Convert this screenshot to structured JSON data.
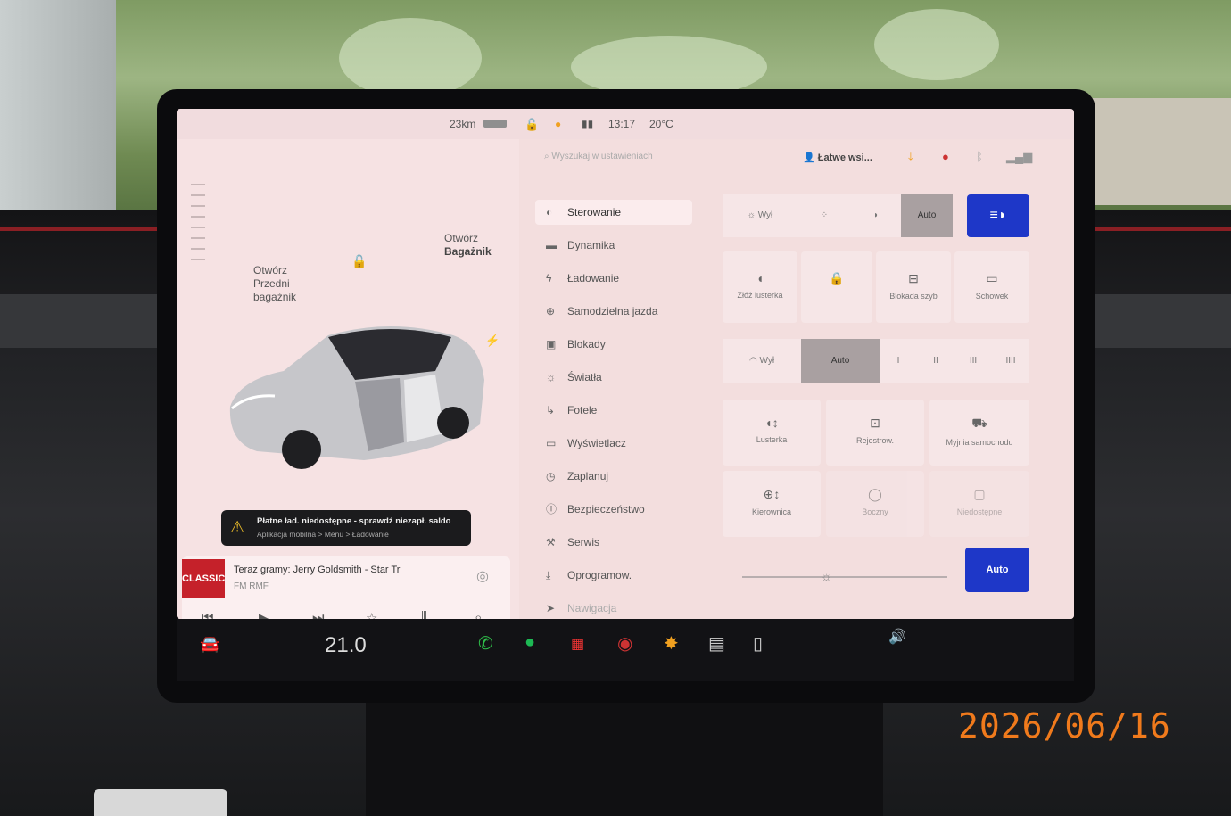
{
  "status_bar": {
    "range": "23km",
    "time": "13:17",
    "temperature": "20°C"
  },
  "car_panel": {
    "front_trunk_label": "Otwórz\nPrzedni\nbagażnik",
    "rear_trunk_label_1": "Otwórz",
    "rear_trunk_label_2": "Bagażnik",
    "warning_title": "Płatne ład. niedostępne - sprawdź niezapł. saldo",
    "warning_sub": "Aplikacja mobilna > Menu > Ładowanie"
  },
  "media": {
    "art_label": "CLASSIC",
    "now_playing": "Teraz gramy: Jerry Goldsmith - Star Tr",
    "station": "FM RMF"
  },
  "settings": {
    "search_placeholder": "Wyszukaj w ustawieniach",
    "profile_name": "Łatwe wsi...",
    "menu": [
      {
        "label": "Sterowanie",
        "icon": "toggle-icon"
      },
      {
        "label": "Dynamika",
        "icon": "car-icon"
      },
      {
        "label": "Ładowanie",
        "icon": "bolt-icon"
      },
      {
        "label": "Samodzielna jazda",
        "icon": "steering-wheel-icon"
      },
      {
        "label": "Blokady",
        "icon": "lock-icon"
      },
      {
        "label": "Światła",
        "icon": "light-icon"
      },
      {
        "label": "Fotele",
        "icon": "seat-icon"
      },
      {
        "label": "Wyświetlacz",
        "icon": "display-icon"
      },
      {
        "label": "Zaplanuj",
        "icon": "clock-icon"
      },
      {
        "label": "Bezpieczeństwo",
        "icon": "info-icon"
      },
      {
        "label": "Serwis",
        "icon": "wrench-icon"
      },
      {
        "label": "Oprogramow.",
        "icon": "download-icon"
      },
      {
        "label": "Nawigacja",
        "icon": "navigation-icon"
      }
    ],
    "lights": {
      "off": "Wył",
      "auto": "Auto"
    },
    "tiles_row1": [
      "Złóż lusterka",
      "Blokada szyb",
      "Schowek"
    ],
    "wipers": {
      "off": "Wył",
      "auto": "Auto",
      "s1": "I",
      "s2": "II",
      "s3": "III",
      "s4": "IIII"
    },
    "tiles_row2": [
      "Lusterka",
      "Rejestrow.",
      "Myjnia samochodu"
    ],
    "tiles_row3": [
      "Kierownica",
      "Boczny",
      "Niedostępne"
    ],
    "brightness_mode": "Auto"
  },
  "bottom_bar": {
    "cabin_temp": "21.0",
    "date_stamp": "2026/06/16"
  }
}
